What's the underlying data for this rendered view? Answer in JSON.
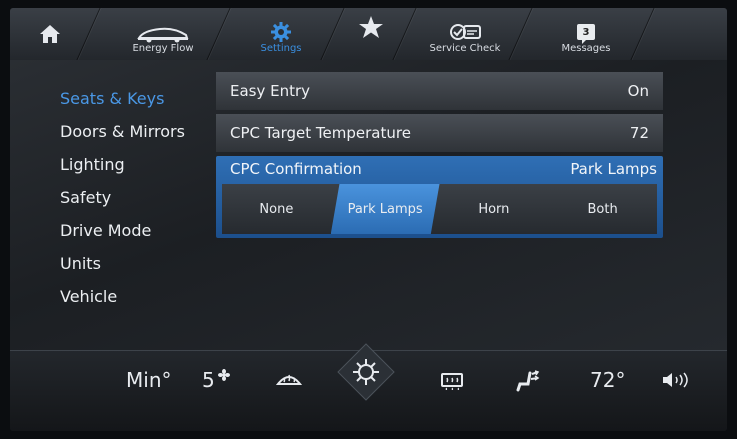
{
  "topbar": {
    "energy_label": "Energy Flow",
    "settings_label": "Settings",
    "service_label": "Service Check",
    "messages_label": "Messages",
    "messages_count": "3"
  },
  "sidebar": {
    "items": [
      {
        "label": "Seats & Keys"
      },
      {
        "label": "Doors & Mirrors"
      },
      {
        "label": "Lighting"
      },
      {
        "label": "Safety"
      },
      {
        "label": "Drive Mode"
      },
      {
        "label": "Units"
      },
      {
        "label": "Vehicle"
      }
    ]
  },
  "settings": {
    "easy_entry": {
      "label": "Easy Entry",
      "value": "On"
    },
    "cpc_temp": {
      "label": "CPC Target Temperature",
      "value": "72"
    },
    "cpc_confirm": {
      "label": "CPC Confirmation",
      "value": "Park Lamps",
      "options": [
        "None",
        "Park Lamps",
        "Horn",
        "Both"
      ]
    }
  },
  "climate": {
    "min_label": "Min°",
    "fan_level": "5",
    "temperature": "72°"
  },
  "colors": {
    "accent": "#3a8fe0",
    "selected": "#2f6fb5"
  }
}
